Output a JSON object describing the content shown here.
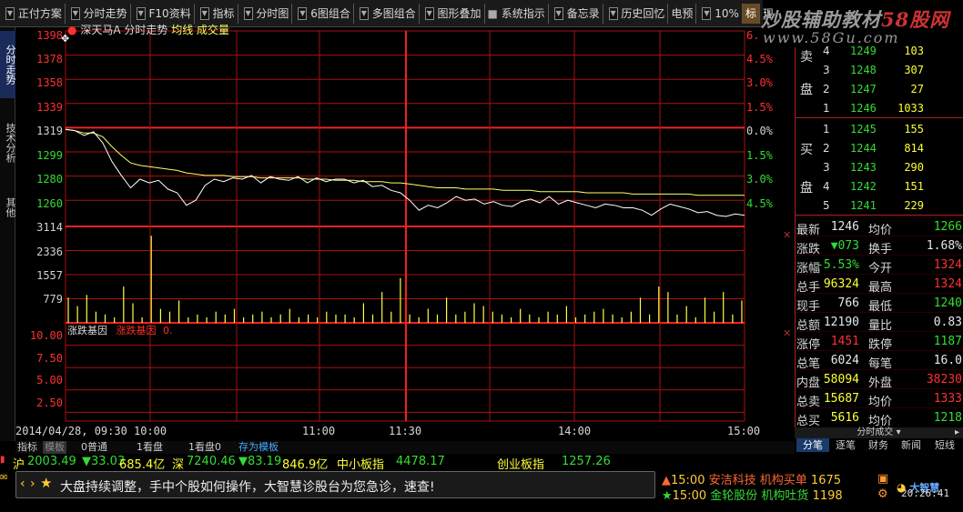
{
  "toolbar": {
    "items": [
      "正付方案",
      "分时走势",
      "F10资料",
      "指标",
      "分时图",
      "6图组合",
      "多图组合",
      "图形叠加",
      "系统指示",
      "备忘录",
      "历史回忆",
      "电预",
      "10%",
      "标",
      "现"
    ]
  },
  "watermark": {
    "line1a": "炒股辅助教材",
    "line1b": "58股网",
    "line2": "www.58Gu.com"
  },
  "left_tabs": [
    "分时走势",
    "技术分析",
    "其他"
  ],
  "chart": {
    "stock_label": "深天马A",
    "title": "分时走势",
    "legend_avg": "均线",
    "legend_vol": "成交量",
    "indicator_label": "涨跌基因",
    "indicator_label2": "涨跌基因",
    "indicator_value": "0.",
    "date_label": "2014/04/28, 09:30",
    "colors": {
      "price": "#ffffff",
      "avg": "#ffff66",
      "grid": "#aa1111",
      "vol": "#ffff44"
    }
  },
  "chart_data": {
    "type": "line",
    "x_labels": [
      "10:00",
      "11:00",
      "11:30",
      "14:00",
      "15:00"
    ],
    "price_ticks": [
      "1398",
      "1378",
      "1358",
      "1339",
      "1319",
      "1299",
      "1280",
      "1260"
    ],
    "pct_ticks_up": [
      "6.",
      "4.5%",
      "3.0%",
      "1.5%"
    ],
    "pct_zero": "0.0%",
    "pct_ticks_down": [
      "1.5%",
      "3.0%",
      "4.5%"
    ],
    "vol_ticks": [
      "3114",
      "2336",
      "1557",
      "779"
    ],
    "ind_ticks": [
      "10.00",
      "7.50",
      "5.00",
      "2.50"
    ],
    "ylim": [
      1241,
      1398
    ],
    "prev_close": 1319,
    "series": [
      {
        "values": [
          1319,
          1318,
          1314,
          1317,
          1308,
          1293,
          1282,
          1272,
          1279,
          1276,
          1278,
          1271,
          1268,
          1258,
          1262,
          1274,
          1279,
          1277,
          1280,
          1279,
          1282,
          1276,
          1281,
          1279,
          1278,
          1281,
          1276,
          1280,
          1277,
          1279,
          1279,
          1276,
          1278,
          1273,
          1274,
          1270,
          1268,
          1262,
          1254,
          1258,
          1256,
          1260,
          1265,
          1262,
          1263,
          1259,
          1261,
          1258,
          1257,
          1261,
          1263,
          1260,
          1265,
          1259,
          1262,
          1260,
          1258,
          1256,
          1259,
          1258,
          1256,
          1256,
          1254,
          1250,
          1255,
          1259,
          1257,
          1255,
          1252,
          1253,
          1250,
          1249,
          1251,
          1250
        ]
      },
      {
        "values": [
          1319,
          1318,
          1316,
          1316,
          1313,
          1305,
          1298,
          1292,
          1290,
          1289,
          1288,
          1287,
          1286,
          1284,
          1283,
          1282,
          1282,
          1282,
          1281,
          1281,
          1281,
          1280,
          1280,
          1280,
          1280,
          1280,
          1279,
          1279,
          1279,
          1278,
          1278,
          1278,
          1277,
          1277,
          1277,
          1276,
          1276,
          1275,
          1274,
          1273,
          1272,
          1272,
          1272,
          1271,
          1271,
          1271,
          1271,
          1270,
          1270,
          1270,
          1270,
          1269,
          1269,
          1269,
          1269,
          1269,
          1268,
          1268,
          1268,
          1268,
          1268,
          1267,
          1267,
          1267,
          1267,
          1267,
          1267,
          1267,
          1266,
          1266,
          1266,
          1266,
          1266,
          1266
        ]
      }
    ],
    "volume": [
      900,
      600,
      1000,
      400,
      300,
      200,
      1300,
      700,
      200,
      3114,
      500,
      400,
      800,
      200,
      300,
      200,
      400,
      300,
      500,
      200,
      300,
      400,
      200,
      300,
      500,
      200,
      300,
      200,
      400,
      300,
      300,
      200,
      700,
      300,
      1100,
      400,
      1600,
      300,
      200,
      500,
      300,
      900,
      300,
      400,
      700,
      600,
      400,
      300,
      200,
      500,
      300,
      200,
      400,
      300,
      600,
      200,
      300,
      400,
      500,
      300,
      200,
      400,
      900,
      300,
      1300,
      1100,
      300,
      600,
      200,
      900,
      400,
      1100,
      300,
      800
    ]
  },
  "order_book": {
    "sell_side_char1": "卖",
    "sell_side_char2": "盘",
    "sell": [
      {
        "n": "4",
        "price": "1249",
        "vol": "103"
      },
      {
        "n": "3",
        "price": "1248",
        "vol": "307"
      },
      {
        "n": "2",
        "price": "1247",
        "vol": "27"
      },
      {
        "n": "1",
        "price": "1246",
        "vol": "1033"
      }
    ],
    "buy_side_char1": "买",
    "buy_side_char2": "盘",
    "buy": [
      {
        "n": "1",
        "price": "1245",
        "vol": "155"
      },
      {
        "n": "2",
        "price": "1244",
        "vol": "814"
      },
      {
        "n": "3",
        "price": "1243",
        "vol": "290"
      },
      {
        "n": "4",
        "price": "1242",
        "vol": "151"
      },
      {
        "n": "5",
        "price": "1241",
        "vol": "229"
      }
    ]
  },
  "quote": {
    "rows": [
      {
        "l1": "最新",
        "v1": "1246",
        "c1": "white",
        "l2": "均价",
        "v2": "1266",
        "c2": "green"
      },
      {
        "l1": "涨跌",
        "v1": "▼073",
        "c1": "green",
        "l2": "换手",
        "v2": "1.68%",
        "c2": "white"
      },
      {
        "l1": "涨幅",
        "v1": "-5.53%",
        "c1": "green",
        "l2": "今开",
        "v2": "1324",
        "c2": "red"
      },
      {
        "l1": "总手",
        "v1": "96324",
        "c1": "yellow",
        "l2": "最高",
        "v2": "1324",
        "c2": "red"
      },
      {
        "l1": "现手",
        "v1": "766",
        "c1": "white",
        "l2": "最低",
        "v2": "1240",
        "c2": "green"
      },
      {
        "l1": "总额",
        "v1": "12190",
        "c1": "white",
        "l2": "量比",
        "v2": "0.83",
        "c2": "white"
      },
      {
        "l1": "涨停",
        "v1": "1451",
        "c1": "red",
        "l2": "跌停",
        "v2": "1187",
        "c2": "green"
      },
      {
        "l1": "总笔",
        "v1": "6024",
        "c1": "white",
        "l2": "每笔",
        "v2": "16.0",
        "c2": "white"
      },
      {
        "l1": "内盘",
        "v1": "58094",
        "c1": "yellow",
        "l2": "外盘",
        "v2": "38230",
        "c2": "red"
      },
      {
        "l1": "总卖",
        "v1": "15687",
        "c1": "yellow",
        "l2": "均价",
        "v2": "1333",
        "c2": "red"
      },
      {
        "l1": "总买",
        "v1": "5616",
        "c1": "yellow",
        "l2": "均价",
        "v2": "1218",
        "c2": "green"
      }
    ]
  },
  "bottom_tabs": [
    "指标",
    "模板",
    "0普通",
    "1看盘",
    "1看盘0",
    "存为模板"
  ],
  "right_tabs": {
    "header": "分时成交",
    "items": [
      "分笔",
      "逐笔",
      "财务",
      "新闻",
      "短线"
    ]
  },
  "index_bar": {
    "sh_label": "沪",
    "sh_value": "2003.49",
    "sh_change": "▼33.03",
    "sh_amount": "685.4亿",
    "sz_label": "深",
    "sz_value": "7240.46",
    "sz_change": "▼83.19",
    "sz_amount": "846.9亿",
    "zx_label": "中小板指",
    "zx_value": "4478.17",
    "cy_label": "创业板指",
    "cy_value": "1257.26"
  },
  "news": {
    "text": "大盘持续调整，手中个股如何操作，大智慧诊股台为您急诊，速查!"
  },
  "alerts": [
    {
      "time": "15:00",
      "name": "安洁科技",
      "action": "机构买单",
      "vol": "1675"
    },
    {
      "time": "15:00",
      "name": "金轮股份",
      "action": "机构吐货",
      "vol": "1198"
    }
  ],
  "brand": {
    "logo_text": "大智慧"
  },
  "clock": "20:26:41"
}
